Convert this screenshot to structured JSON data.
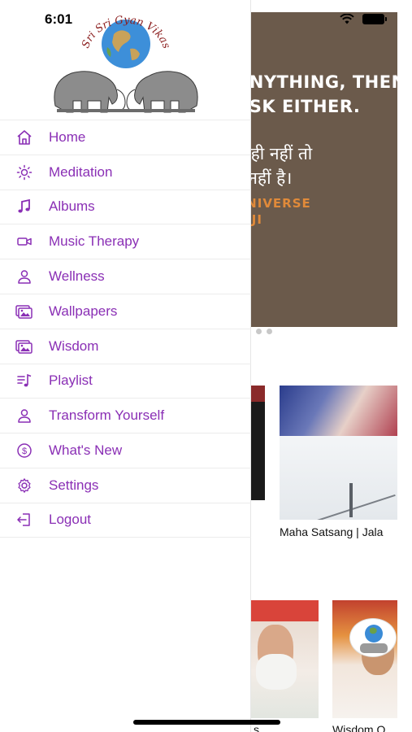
{
  "status_bar": {
    "time": "6:01"
  },
  "logo": {
    "text": "Sri Sri Gyan Vikas Kendra"
  },
  "quote": {
    "line1": "ANYTHING, THEN",
    "line2": "ASK EITHER.",
    "hindi1": "ते ही नहीं तो",
    "hindi2": "र नहीं है।",
    "attr1": "UNIVERSE",
    "attr2": "N JI"
  },
  "content": {
    "video_caption": "Maha Satsang | Jala",
    "caption_2": "s",
    "caption_3": "Wisdom Q"
  },
  "menu": {
    "items": [
      {
        "label": "Home",
        "icon": "home-icon"
      },
      {
        "label": "Meditation",
        "icon": "sun-icon"
      },
      {
        "label": "Albums",
        "icon": "music-note-icon"
      },
      {
        "label": "Music Therapy",
        "icon": "video-camera-icon"
      },
      {
        "label": "Wellness",
        "icon": "person-icon"
      },
      {
        "label": "Wallpapers",
        "icon": "image-stack-icon"
      },
      {
        "label": "Wisdom",
        "icon": "image-stack-icon"
      },
      {
        "label": "Playlist",
        "icon": "playlist-icon"
      },
      {
        "label": "Transform Yourself",
        "icon": "person-icon"
      },
      {
        "label": "What's New",
        "icon": "dollar-circle-icon"
      },
      {
        "label": "Settings",
        "icon": "gear-icon"
      },
      {
        "label": "Logout",
        "icon": "logout-icon"
      }
    ]
  },
  "colors": {
    "accent": "#8a2fb5",
    "quote_bg": "#6b5a4b",
    "quote_highlight": "#e08a3a"
  }
}
